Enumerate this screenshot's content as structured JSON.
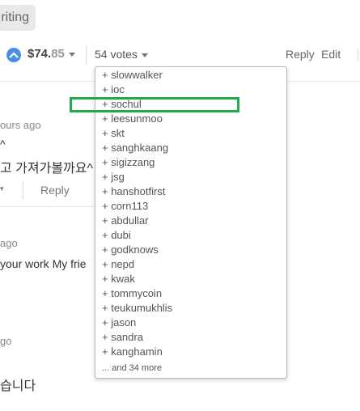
{
  "tag": {
    "label": "riting"
  },
  "post_footer": {
    "payout_main": "$74.",
    "payout_cents": "85",
    "votes_label": "54 votes",
    "reply": "Reply",
    "edit": "Edit"
  },
  "comments": [
    {
      "time": "ours ago",
      "line1": "^",
      "line2": "고 가져가볼까요^",
      "reply": "Reply"
    },
    {
      "time": "ago",
      "line1": "your work My frie"
    },
    {
      "time": "go",
      "line1": "습니다"
    }
  ],
  "voters": [
    "slowwalker",
    "ioc",
    "sochul",
    "leesunmoo",
    "skt",
    "sanghkaang",
    "sigizzang",
    "jsg",
    "hanshotfirst",
    "corn113",
    "abdullar",
    "dubi",
    "godknows",
    "nepd",
    "kwak",
    "tommycoin",
    "teukumukhlis",
    "jason",
    "sandra",
    "kanghamin"
  ],
  "voters_more": "... and 34 more",
  "colors": {
    "highlight": "#22aa4a",
    "upvote": "#4a90e2"
  }
}
